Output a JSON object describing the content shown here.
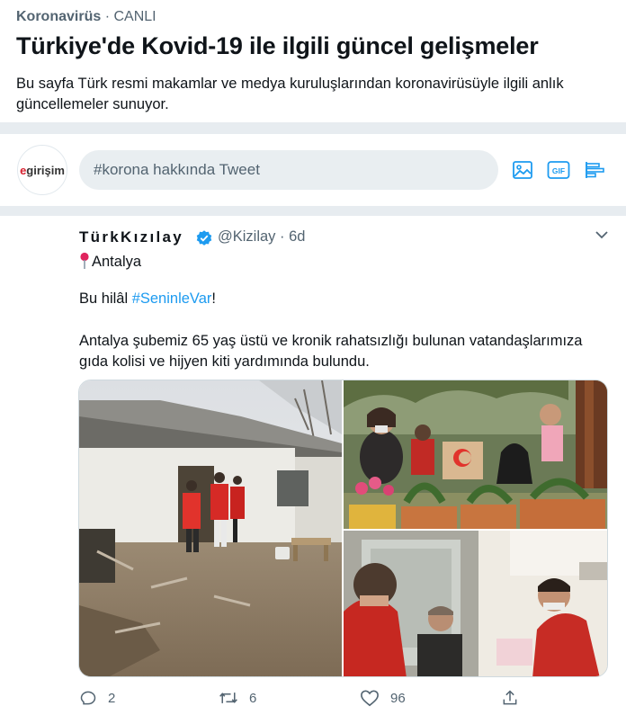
{
  "header": {
    "category": "Koronavirüs",
    "dot": "·",
    "live": "CANLI",
    "title": "Türkiye'de Kovid-19 ile ilgili güncel gelişmeler",
    "description": "Bu sayfa Türk resmi makamlar ve medya kuruluşlarından koronavirüsüyle ilgili anlık güncellemeler sunuyor."
  },
  "compose": {
    "avatar_text_red": "e",
    "avatar_text": "girişim",
    "placeholder": "#korona hakkında Tweet",
    "icons": [
      "image-icon",
      "gif-icon",
      "poll-icon"
    ]
  },
  "tweet": {
    "author_name": "TürkKızılay",
    "handle": "@Kizilay",
    "time": "· 6d",
    "location": "Antalya",
    "line1_prefix": "Bu hilâl ",
    "line1_hashtag": "#SeninleVar",
    "line1_suffix": "!",
    "body": "Antalya şubemiz 65 yaş üstü ve kronik rahatsızlığı bulunan vatandaşlarımıza gıda kolisi ve hijyen kiti yardımında bulundu.",
    "actions": {
      "reply_count": "2",
      "retweet_count": "6",
      "like_count": "96"
    }
  }
}
